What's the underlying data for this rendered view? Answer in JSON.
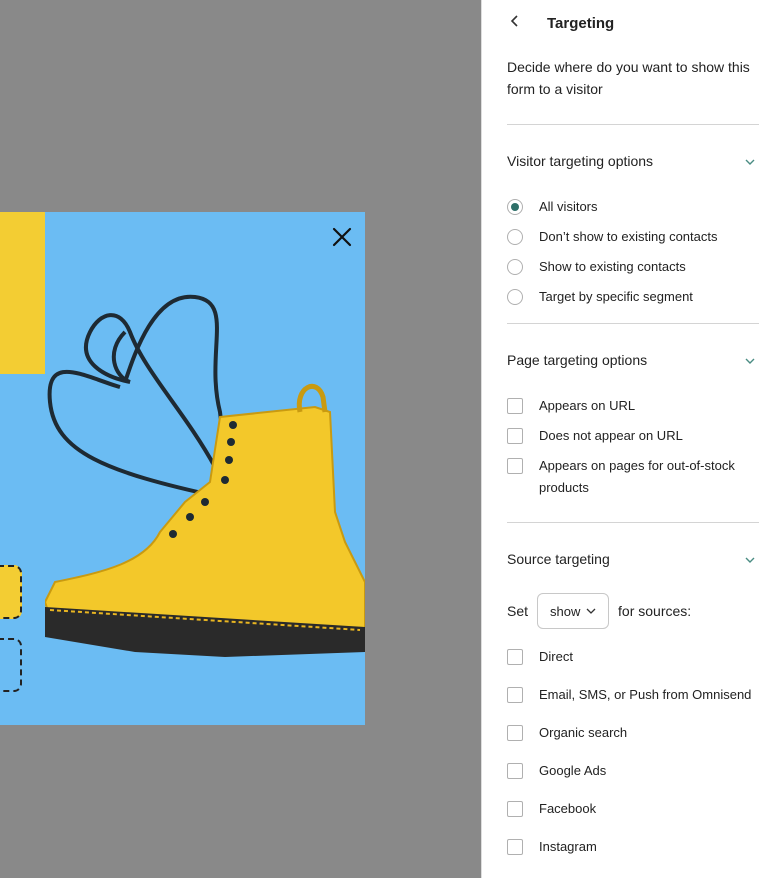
{
  "panel": {
    "title": "Targeting",
    "description": "Decide where do you want to show this form to a visitor"
  },
  "visitor_targeting": {
    "title": "Visitor targeting options",
    "options": [
      {
        "label": "All visitors",
        "selected": true
      },
      {
        "label": "Don’t show to existing contacts",
        "selected": false
      },
      {
        "label": "Show to existing contacts",
        "selected": false
      },
      {
        "label": "Target by specific segment",
        "selected": false
      }
    ]
  },
  "page_targeting": {
    "title": "Page targeting options",
    "options": [
      {
        "label": "Appears on URL",
        "checked": false
      },
      {
        "label": "Does not appear on URL",
        "checked": false
      },
      {
        "label": "Appears on pages for out-of-stock products",
        "checked": false
      }
    ]
  },
  "source_targeting": {
    "title": "Source targeting",
    "set_label": "Set",
    "select_value": "show",
    "suffix": "for sources:",
    "options": [
      {
        "label": "Direct",
        "checked": false
      },
      {
        "label": "Email, SMS, or Push from Omnisend",
        "checked": false
      },
      {
        "label": "Organic search",
        "checked": false
      },
      {
        "label": "Google Ads",
        "checked": false
      },
      {
        "label": "Facebook",
        "checked": false
      },
      {
        "label": "Instagram",
        "checked": false
      }
    ]
  },
  "colors": {
    "accent": "#2e6f68",
    "preview_bg": "#898989",
    "popup_blue": "#6bbcf3",
    "popup_yellow": "#f3cd33"
  },
  "icons": {
    "back": "chevron-left-icon",
    "close": "close-icon",
    "expand": "chevron-down-icon"
  }
}
